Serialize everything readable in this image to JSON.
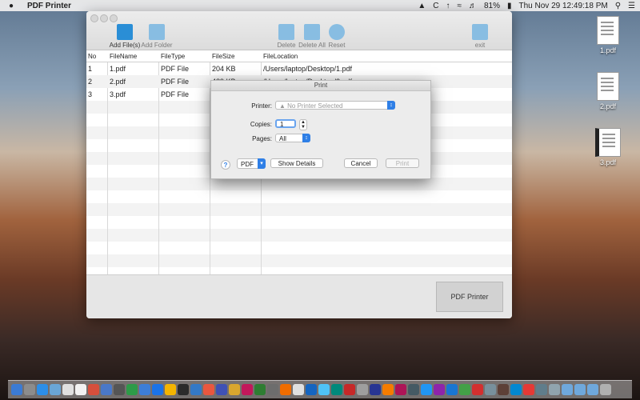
{
  "menubar": {
    "app_name": "PDF Printer",
    "battery": "81%",
    "datetime": "Thu Nov 29  12:49:18 PM",
    "input_source": "C"
  },
  "desktop_files": [
    "1.pdf",
    "2.pdf",
    "3.pdf"
  ],
  "toolbar": {
    "add_files": "Add File(s)",
    "add_folder": "Add Folder",
    "delete": "Delete",
    "delete_all": "Delete All",
    "reset": "Reset",
    "exit": "exit"
  },
  "table": {
    "headers": [
      "No",
      "FileName",
      "FileType",
      "FileSize",
      "FileLocation"
    ],
    "rows": [
      {
        "no": "1",
        "name": "1.pdf",
        "type": "PDF File",
        "size": "204 KB",
        "location": "/Users/laptop/Desktop/1.pdf"
      },
      {
        "no": "2",
        "name": "2.pdf",
        "type": "PDF File",
        "size": "489 KB",
        "location": "/Users/laptop/Desktop/2.pdf"
      },
      {
        "no": "3",
        "name": "3.pdf",
        "type": "PDF File",
        "size": "",
        "location": ""
      }
    ]
  },
  "main_button": "PDF Printer",
  "print_dialog": {
    "title": "Print",
    "printer_label": "Printer:",
    "printer_value": "No Printer Selected",
    "copies_label": "Copies:",
    "copies_value": "1",
    "pages_label": "Pages:",
    "pages_value": "All",
    "help": "?",
    "pdf_menu": "PDF",
    "show_details": "Show Details",
    "cancel": "Cancel",
    "print": "Print"
  },
  "colors": {
    "accent": "#2f7fe6",
    "toolbar_icon": "#2a8ed6"
  },
  "dock_icon_colors": [
    "#3b7bd4",
    "#8c8c8c",
    "#2c8ee8",
    "#6aa6d6",
    "#e0e0e0",
    "#f2f2f2",
    "#d64f3c",
    "#4a78c8",
    "#555555",
    "#2d9b48",
    "#3d7ed8",
    "#1a73e8",
    "#f4b400",
    "#2b2b2b",
    "#3479c6",
    "#e9573f",
    "#3f51b5",
    "#d9a62e",
    "#c2185b",
    "#2e7d32",
    "#6d6d6d",
    "#ef6c00",
    "#e0e0e0",
    "#1565c0",
    "#4fc3f7",
    "#00897b",
    "#c62828",
    "#9e9e9e",
    "#283593",
    "#f57c00",
    "#ad1457",
    "#455a64",
    "#2196f3",
    "#8e24aa",
    "#1976d2",
    "#43a047",
    "#d32f2f",
    "#78909c",
    "#5d4037",
    "#0288d1",
    "#e53935",
    "#607d8b",
    "#90a4ae",
    "#6fa8dc",
    "#6fa8dc",
    "#6fa8dc",
    "#b0b0b0"
  ]
}
